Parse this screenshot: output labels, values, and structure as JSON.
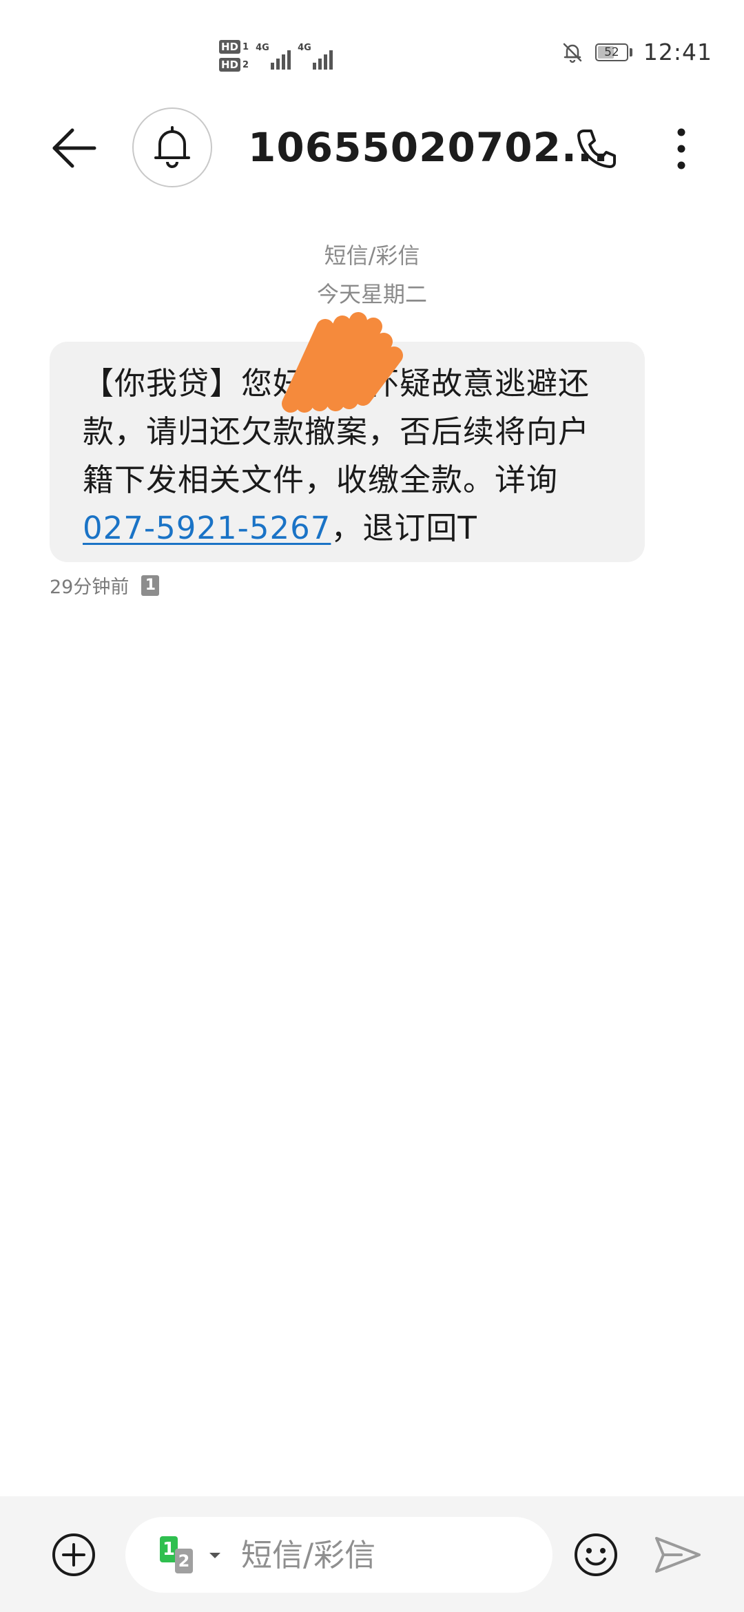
{
  "status_bar": {
    "hd1": "HD",
    "hd1_num": "1",
    "hd2": "HD",
    "hd2_num": "2",
    "network1": "4G",
    "network2": "4G",
    "battery_level": "52",
    "time": "12:41"
  },
  "header": {
    "title": "10655020702...",
    "avatar_icon": "bell-icon",
    "back_icon": "back-arrow-icon",
    "call_icon": "phone-icon",
    "more_icon": "more-vertical-icon"
  },
  "conversation": {
    "channel_label": "短信/彩信",
    "date_label": "今天星期二",
    "message": {
      "line1": "【你我贷】您好，已怀疑故意逃避还",
      "line2": "款，请归还欠款撤案，否后续将向户",
      "line3": "籍下发相关文件，收缴全款。详询",
      "link": "027-5921-5267",
      "line4_tail": "，退订回T"
    },
    "time": "29分钟前",
    "sim_badge": "1"
  },
  "composer": {
    "sim1": "1",
    "sim2": "2",
    "placeholder": "短信/彩信",
    "add_icon": "plus-circle-icon",
    "emoji_icon": "emoji-icon",
    "send_icon": "send-icon"
  },
  "colors": {
    "link": "#1a73c6",
    "bubble": "#f1f1f1",
    "sim_green": "#2fbf4f",
    "scribble": "#f58a3c"
  }
}
